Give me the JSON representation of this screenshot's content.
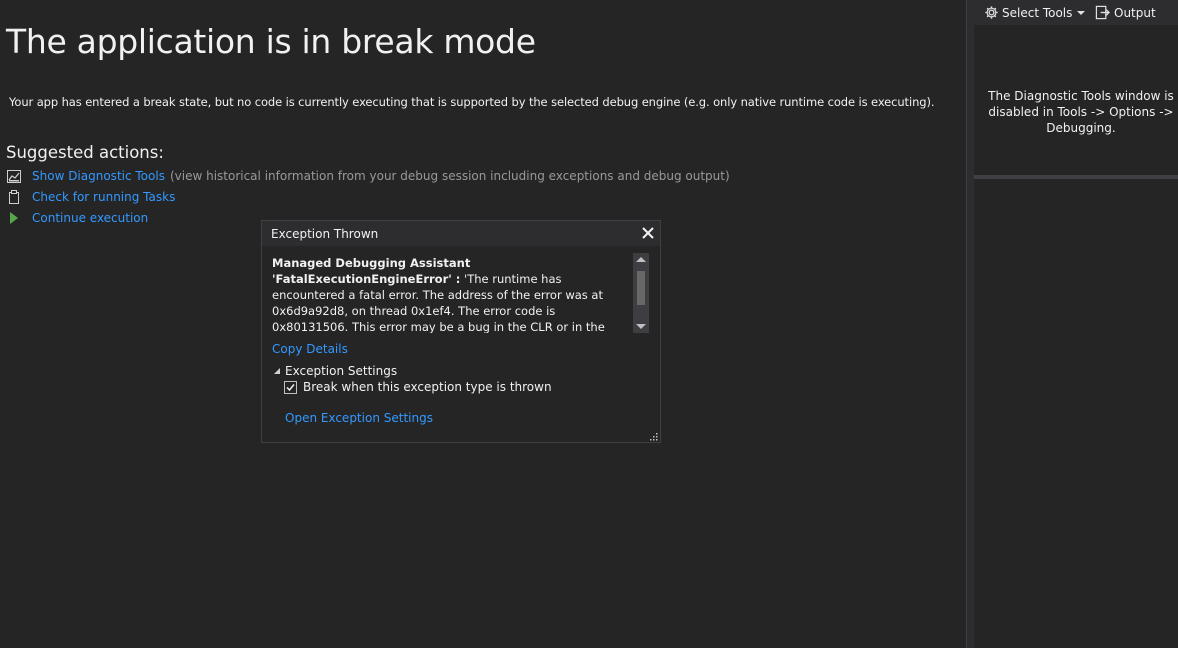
{
  "main": {
    "title": "The application is in break mode",
    "description": "Your app has entered a break state, but no code is currently executing that is supported by the selected debug engine (e.g. only native runtime code is executing).",
    "suggested_heading": "Suggested actions:",
    "actions": [
      {
        "label": "Show Diagnostic Tools",
        "note": "(view historical information from your debug session including exceptions and debug output)",
        "icon": "diagnostic-tools-icon"
      },
      {
        "label": "Check for running Tasks",
        "note": "",
        "icon": "clipboard-icon"
      },
      {
        "label": "Continue execution",
        "note": "",
        "icon": "play-icon"
      }
    ]
  },
  "diagnostic": {
    "select_tools_label": "Select Tools",
    "output_label": "Output",
    "message": "The Diagnostic Tools window is disabled in Tools -> Options -> Debugging."
  },
  "exception": {
    "header_title": "Exception Thrown",
    "message_bold": "Managed Debugging Assistant 'FatalExecutionEngineError' :",
    "message_body": "'The runtime has encountered a fatal error. The address of the error was at 0x6d9a92d8, on thread 0x1ef4. The error code is 0x80131506. This error may be a bug in the CLR or in the unsafe or non-verifiable portions of user code. Common sources of this bug",
    "copy_details": "Copy Details",
    "settings_heading": "Exception Settings",
    "break_checkbox_label": "Break when this exception type is thrown",
    "break_checked": true,
    "open_settings": "Open Exception Settings"
  },
  "colors": {
    "background": "#252526",
    "link": "#3399ff",
    "play_green": "#57a64a",
    "muted_text": "#999999"
  }
}
